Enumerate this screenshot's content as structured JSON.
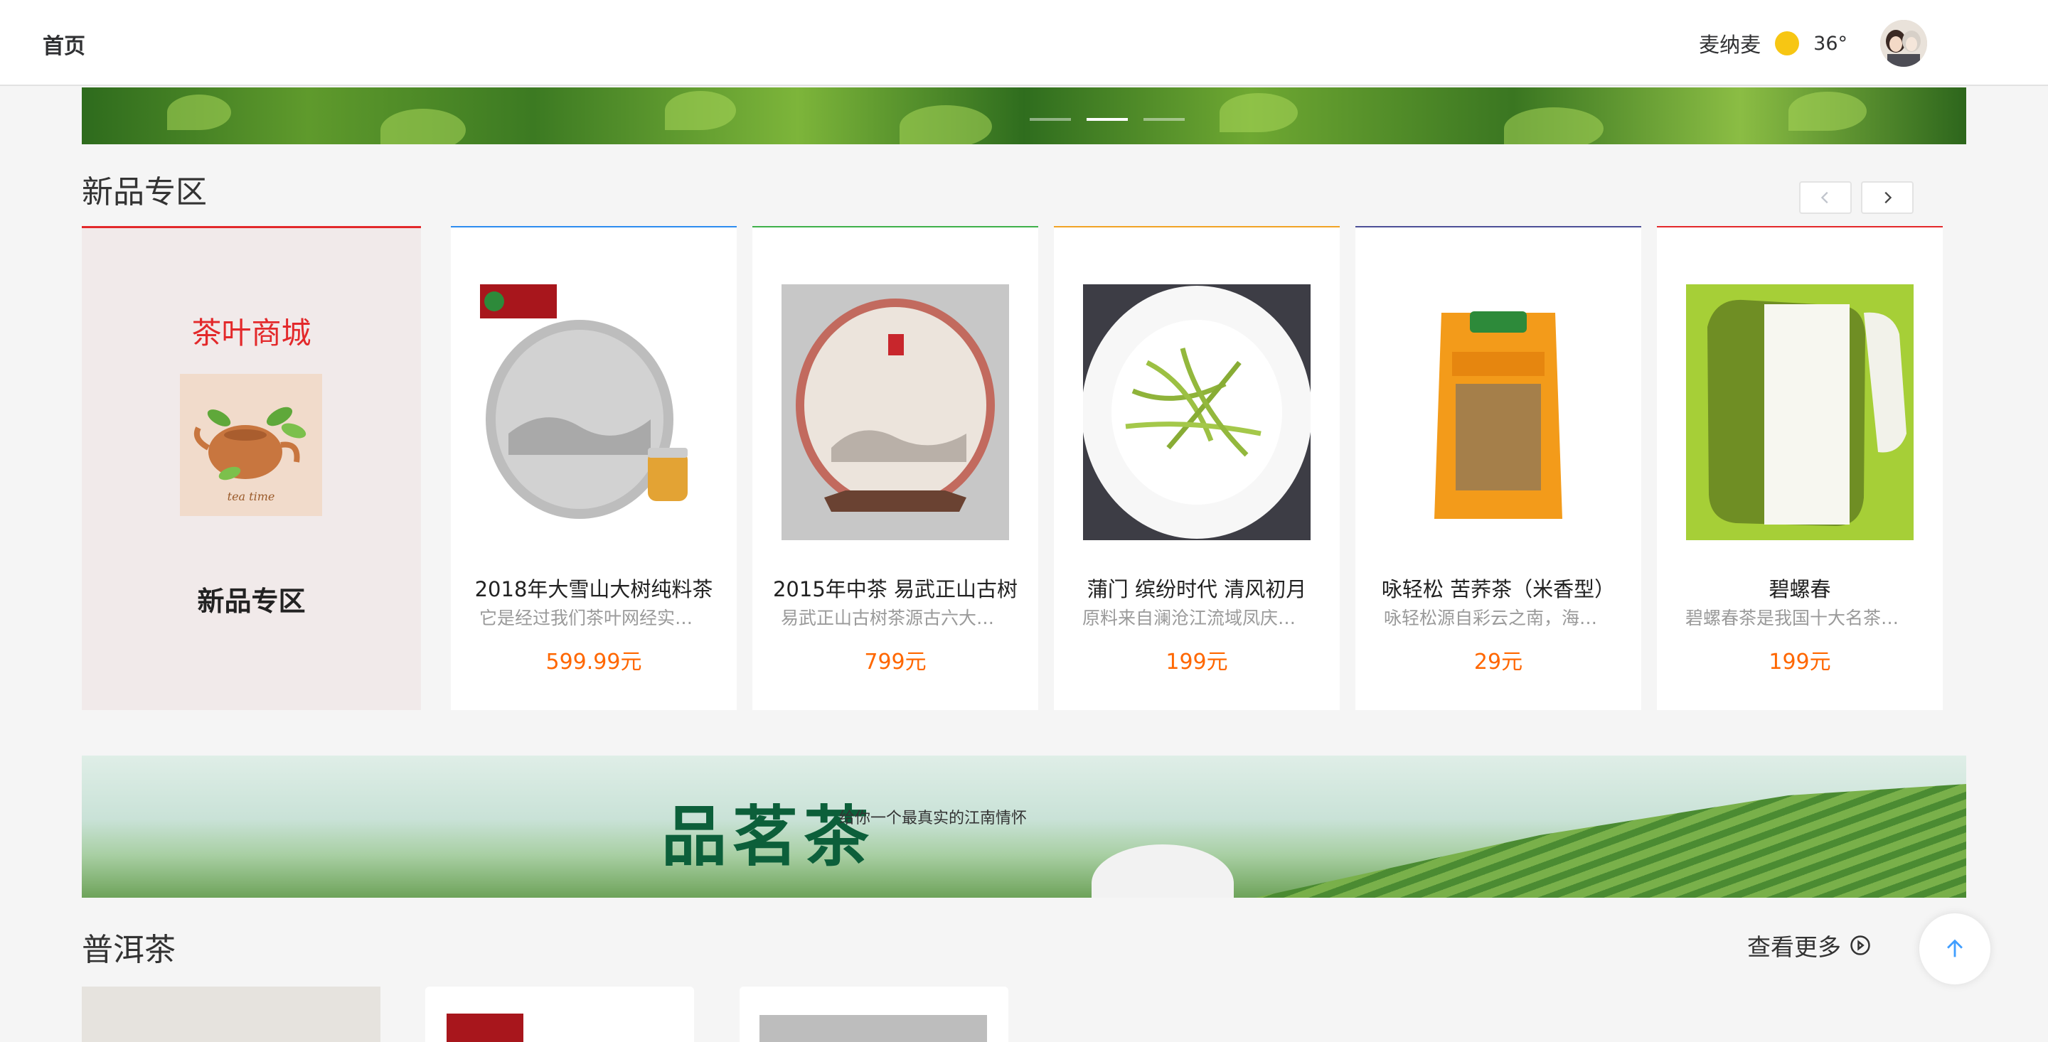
{
  "header": {
    "home_label": "首页",
    "username": "麦纳麦",
    "weather_icon": "sun-icon",
    "temperature": "36°"
  },
  "carousel": {
    "slide_count": 3,
    "active_index": 1
  },
  "new_section": {
    "title": "新品专区",
    "feature": {
      "brand": "茶叶商城",
      "logo_text": "tea time",
      "label": "新品专区"
    },
    "products": [
      {
        "name": "2018年大雪山大树纯料茶",
        "desc": "它是经过我们茶叶网经实地...",
        "price": "599.99元",
        "accent": "#2d8cf0"
      },
      {
        "name": "2015年中茶 易武正山古树",
        "desc": "易武正山古树茶源古六大茶...",
        "price": "799元",
        "accent": "#3fb04a"
      },
      {
        "name": "蒲门 缤纷时代 清风初月",
        "desc": "原料来自澜沧江流域凤庆古...",
        "price": "199元",
        "accent": "#f1a325"
      },
      {
        "name": "咏轻松 苦荞茶（米香型）",
        "desc": "咏轻松源自彩云之南，海拔...",
        "price": "29元",
        "accent": "#4c4f96"
      },
      {
        "name": "碧螺春",
        "desc": "碧螺春茶是我国十大名茶之...",
        "price": "199元",
        "accent": "#e3292b"
      }
    ]
  },
  "mid_banner": {
    "headline": "品茗茶",
    "tagline": "给你一个最真实的江南情怀"
  },
  "puer_section": {
    "title": "普洱茶",
    "view_more": "查看更多"
  },
  "colors": {
    "price": "#ff6700",
    "brand_red": "#e3292b",
    "feature_bg": "#f1eaea"
  }
}
